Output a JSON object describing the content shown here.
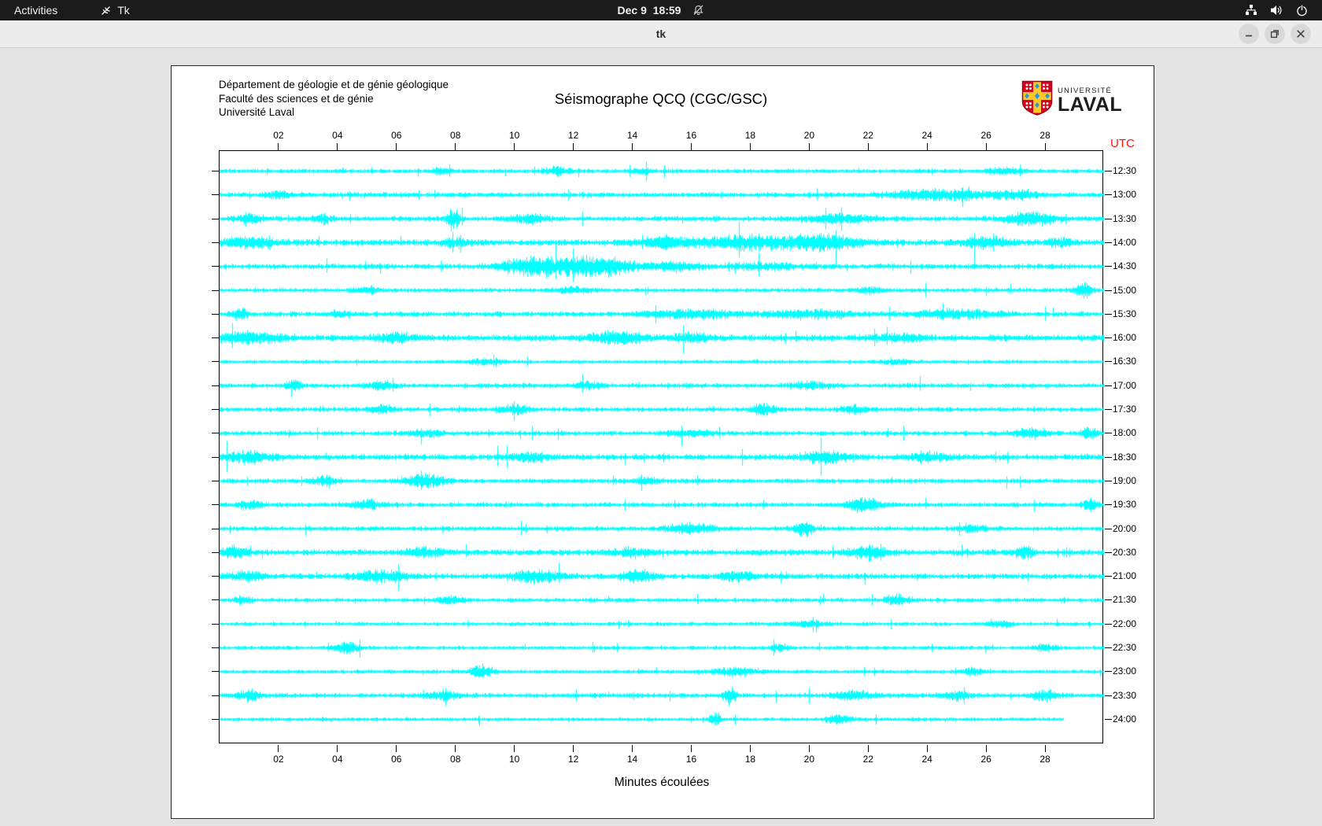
{
  "top_bar": {
    "activities_label": "Activities",
    "app_name": "Tk",
    "clock": "Dec 9  18:59",
    "icons": [
      "tk-app",
      "bell-crossed",
      "wired-network",
      "volume",
      "power"
    ]
  },
  "window": {
    "title": "tk",
    "controls": [
      "minimize",
      "restore",
      "close"
    ]
  },
  "document": {
    "org_lines": [
      "Département de géologie et de génie géologique",
      "Faculté des sciences et de génie",
      "Université Laval"
    ],
    "title": "Séismographe QCQ (CGC/GSC)",
    "logo": {
      "top": "UNIVERSITÉ",
      "bottom": "LAVAL"
    }
  },
  "chart_data": {
    "type": "line",
    "title": "Séismographe QCQ (CGC/GSC)",
    "xlabel": "Minutes écoulées",
    "x_ticks": [
      "02",
      "04",
      "06",
      "08",
      "10",
      "12",
      "14",
      "16",
      "18",
      "20",
      "22",
      "24",
      "26",
      "28"
    ],
    "x_range": [
      0,
      30
    ],
    "utc_label": "UTC",
    "utc_color": "#fb1408",
    "trace_color": "#00ffff",
    "axis_color": "#000000",
    "rows": [
      {
        "utc": "12:30",
        "base": 2.0,
        "end": 30,
        "bursts": [
          {
            "m": 7.5,
            "a": 3,
            "w": 0.3
          },
          {
            "m": 11.5,
            "a": 4,
            "w": 0.3
          },
          {
            "m": 14.3,
            "a": 3,
            "w": 0.2
          },
          {
            "m": 26.5,
            "a": 3,
            "w": 0.4
          }
        ]
      },
      {
        "utc": "13:00",
        "base": 2.4,
        "end": 30,
        "bursts": [
          {
            "m": 2,
            "a": 3,
            "w": 0.3
          },
          {
            "m": 24.5,
            "a": 5,
            "w": 1.2
          },
          {
            "m": 27,
            "a": 4,
            "w": 0.5
          }
        ]
      },
      {
        "utc": "13:30",
        "base": 2.4,
        "end": 30,
        "bursts": [
          {
            "m": 1,
            "a": 4,
            "w": 0.3
          },
          {
            "m": 3.5,
            "a": 4,
            "w": 0.2
          },
          {
            "m": 7.9,
            "a": 10,
            "w": 0.15
          },
          {
            "m": 10.5,
            "a": 4,
            "w": 0.4
          },
          {
            "m": 21,
            "a": 4,
            "w": 0.8
          },
          {
            "m": 27.5,
            "a": 6,
            "w": 0.6
          }
        ]
      },
      {
        "utc": "14:00",
        "base": 2.9,
        "end": 30,
        "bursts": [
          {
            "m": 1,
            "a": 5,
            "w": 0.6
          },
          {
            "m": 8,
            "a": 4,
            "w": 0.3
          },
          {
            "m": 15,
            "a": 5,
            "w": 0.5
          },
          {
            "m": 18,
            "a": 6,
            "w": 1.5
          },
          {
            "m": 20.5,
            "a": 6,
            "w": 0.8
          },
          {
            "m": 26,
            "a": 6,
            "w": 0.5
          },
          {
            "m": 28.5,
            "a": 4,
            "w": 0.3
          }
        ]
      },
      {
        "utc": "14:30",
        "base": 2.4,
        "end": 30,
        "bursts": [
          {
            "m": 10.3,
            "a": 6,
            "w": 0.6
          },
          {
            "m": 11.8,
            "a": 8,
            "w": 1.0
          },
          {
            "m": 13.2,
            "a": 6,
            "w": 0.7
          },
          {
            "m": 15.5,
            "a": 4,
            "w": 0.6
          },
          {
            "m": 18.5,
            "a": 3,
            "w": 0.8
          }
        ]
      },
      {
        "utc": "15:00",
        "base": 2.0,
        "end": 30,
        "bursts": [
          {
            "m": 5,
            "a": 3,
            "w": 0.3
          },
          {
            "m": 12,
            "a": 3,
            "w": 0.4
          },
          {
            "m": 22,
            "a": 3,
            "w": 0.3
          },
          {
            "m": 29.3,
            "a": 7,
            "w": 0.2
          }
        ]
      },
      {
        "utc": "15:30",
        "base": 2.4,
        "end": 30,
        "bursts": [
          {
            "m": 0.7,
            "a": 5,
            "w": 0.2
          },
          {
            "m": 4,
            "a": 3,
            "w": 0.3
          },
          {
            "m": 16,
            "a": 4,
            "w": 1.0
          },
          {
            "m": 20,
            "a": 4,
            "w": 1.0
          },
          {
            "m": 25,
            "a": 4,
            "w": 1.0
          }
        ]
      },
      {
        "utc": "16:00",
        "base": 2.9,
        "end": 30,
        "bursts": [
          {
            "m": 1,
            "a": 5,
            "w": 0.8
          },
          {
            "m": 6,
            "a": 4,
            "w": 0.5
          },
          {
            "m": 13.5,
            "a": 6,
            "w": 0.6
          },
          {
            "m": 16,
            "a": 4,
            "w": 0.4
          },
          {
            "m": 23,
            "a": 3,
            "w": 0.6
          }
        ]
      },
      {
        "utc": "16:30",
        "base": 1.8,
        "end": 30,
        "bursts": [
          {
            "m": 9,
            "a": 3,
            "w": 0.4
          },
          {
            "m": 23,
            "a": 3,
            "w": 0.3
          }
        ]
      },
      {
        "utc": "17:00",
        "base": 2.2,
        "end": 30,
        "bursts": [
          {
            "m": 2.5,
            "a": 5,
            "w": 0.2
          },
          {
            "m": 5.5,
            "a": 4,
            "w": 0.3
          },
          {
            "m": 12.5,
            "a": 3,
            "w": 0.3
          },
          {
            "m": 20,
            "a": 3,
            "w": 0.5
          }
        ]
      },
      {
        "utc": "17:30",
        "base": 2.2,
        "end": 30,
        "bursts": [
          {
            "m": 5.5,
            "a": 4,
            "w": 0.3
          },
          {
            "m": 10,
            "a": 5,
            "w": 0.3
          },
          {
            "m": 18.5,
            "a": 5,
            "w": 0.3
          },
          {
            "m": 21.5,
            "a": 4,
            "w": 0.3
          }
        ]
      },
      {
        "utc": "18:00",
        "base": 2.2,
        "end": 30,
        "bursts": [
          {
            "m": 7,
            "a": 3,
            "w": 0.4
          },
          {
            "m": 16,
            "a": 3,
            "w": 0.6
          },
          {
            "m": 27.5,
            "a": 5,
            "w": 0.4
          },
          {
            "m": 29.5,
            "a": 6,
            "w": 0.2
          }
        ]
      },
      {
        "utc": "18:30",
        "base": 2.7,
        "end": 30,
        "bursts": [
          {
            "m": 1,
            "a": 5,
            "w": 0.6
          },
          {
            "m": 10.5,
            "a": 4,
            "w": 0.5
          },
          {
            "m": 20.5,
            "a": 6,
            "w": 0.5
          },
          {
            "m": 24,
            "a": 4,
            "w": 0.5
          }
        ]
      },
      {
        "utc": "19:00",
        "base": 2.2,
        "end": 30,
        "bursts": [
          {
            "m": 3.5,
            "a": 4,
            "w": 0.3
          },
          {
            "m": 7,
            "a": 6,
            "w": 0.5
          },
          {
            "m": 14.5,
            "a": 3,
            "w": 0.3
          }
        ]
      },
      {
        "utc": "19:30",
        "base": 2.2,
        "end": 30,
        "bursts": [
          {
            "m": 1,
            "a": 4,
            "w": 0.3
          },
          {
            "m": 5,
            "a": 4,
            "w": 0.4
          },
          {
            "m": 21.8,
            "a": 7,
            "w": 0.4
          },
          {
            "m": 29.5,
            "a": 5,
            "w": 0.2
          }
        ]
      },
      {
        "utc": "20:00",
        "base": 2.2,
        "end": 30,
        "bursts": [
          {
            "m": 16,
            "a": 4,
            "w": 0.6
          },
          {
            "m": 19.8,
            "a": 7,
            "w": 0.2
          },
          {
            "m": 25.5,
            "a": 4,
            "w": 0.3
          }
        ]
      },
      {
        "utc": "20:30",
        "base": 2.7,
        "end": 30,
        "bursts": [
          {
            "m": 0.5,
            "a": 6,
            "w": 0.3
          },
          {
            "m": 7,
            "a": 4,
            "w": 0.5
          },
          {
            "m": 14,
            "a": 4,
            "w": 0.5
          },
          {
            "m": 22,
            "a": 5,
            "w": 0.5
          },
          {
            "m": 27.3,
            "a": 6,
            "w": 0.2
          }
        ]
      },
      {
        "utc": "21:00",
        "base": 2.7,
        "end": 30,
        "bursts": [
          {
            "m": 1,
            "a": 4,
            "w": 0.4
          },
          {
            "m": 5.5,
            "a": 5,
            "w": 0.6
          },
          {
            "m": 10.7,
            "a": 6,
            "w": 0.6
          },
          {
            "m": 14.2,
            "a": 5,
            "w": 0.4
          },
          {
            "m": 17.5,
            "a": 4,
            "w": 0.4
          }
        ]
      },
      {
        "utc": "21:30",
        "base": 2.0,
        "end": 30,
        "bursts": [
          {
            "m": 0.8,
            "a": 4,
            "w": 0.2
          },
          {
            "m": 7.8,
            "a": 3,
            "w": 0.3
          },
          {
            "m": 23,
            "a": 5,
            "w": 0.3
          }
        ]
      },
      {
        "utc": "22:00",
        "base": 1.8,
        "end": 30,
        "bursts": [
          {
            "m": 20,
            "a": 3,
            "w": 0.4
          },
          {
            "m": 26.5,
            "a": 3,
            "w": 0.3
          }
        ]
      },
      {
        "utc": "22:30",
        "base": 1.8,
        "end": 30,
        "bursts": [
          {
            "m": 4.3,
            "a": 6,
            "w": 0.3
          },
          {
            "m": 19,
            "a": 4,
            "w": 0.2
          },
          {
            "m": 28,
            "a": 3,
            "w": 0.3
          }
        ]
      },
      {
        "utc": "23:00",
        "base": 1.8,
        "end": 30,
        "bursts": [
          {
            "m": 8.9,
            "a": 6,
            "w": 0.3
          },
          {
            "m": 17.5,
            "a": 4,
            "w": 0.6
          },
          {
            "m": 25.5,
            "a": 3,
            "w": 0.3
          }
        ]
      },
      {
        "utc": "23:30",
        "base": 2.2,
        "end": 30,
        "bursts": [
          {
            "m": 1,
            "a": 5,
            "w": 0.3
          },
          {
            "m": 7.5,
            "a": 4,
            "w": 0.4
          },
          {
            "m": 17.3,
            "a": 9,
            "w": 0.15
          },
          {
            "m": 21.5,
            "a": 4,
            "w": 0.5
          },
          {
            "m": 25,
            "a": 4,
            "w": 0.3
          },
          {
            "m": 28,
            "a": 5,
            "w": 0.3
          }
        ]
      },
      {
        "utc": "24:00",
        "base": 1.8,
        "end": 28.6,
        "bursts": [
          {
            "m": 16.8,
            "a": 9,
            "w": 0.12
          },
          {
            "m": 21,
            "a": 4,
            "w": 0.3
          }
        ]
      }
    ]
  }
}
